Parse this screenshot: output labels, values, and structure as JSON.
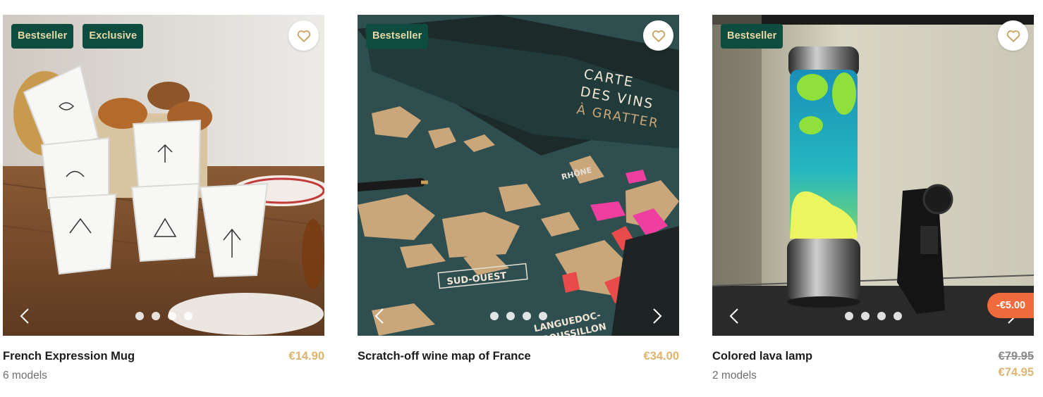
{
  "colors": {
    "badge_bg": "#0e4c40",
    "badge_text": "#e7d9a6",
    "price": "#dfb46e",
    "old_price": "#8a8a8a",
    "discount_bg": "#ef6b3e",
    "heart": "#c9a35f"
  },
  "products": [
    {
      "badges": [
        "Bestseller",
        "Exclusive"
      ],
      "image_icon": "mug-photo",
      "name": "French Expression Mug",
      "models": "6 models",
      "price": "€14.90",
      "slides": 4
    },
    {
      "badges": [
        "Bestseller"
      ],
      "image_icon": "map-photo",
      "name": "Scratch-off wine map of France",
      "price": "€34.00",
      "slides": 4,
      "image_text": [
        "CARTE",
        "DES VINS",
        "À GRATTER",
        "SUD-OUEST",
        "RHÔNE",
        "LANGUEDOC-",
        "ROUSSILLON"
      ]
    },
    {
      "badges": [
        "Bestseller"
      ],
      "image_icon": "lava-lamp-photo",
      "name": "Colored lava lamp",
      "models": "2 models",
      "old_price": "€79.95",
      "price": "€74.95",
      "discount": "-€5.00",
      "slides": 4
    }
  ]
}
